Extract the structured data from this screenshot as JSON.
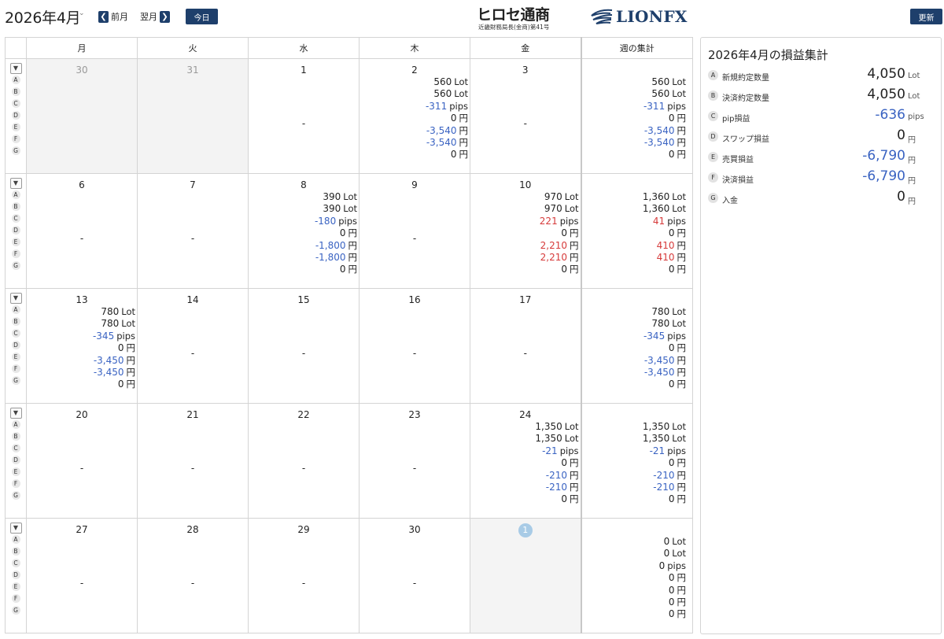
{
  "header": {
    "month_title": "2026年4月",
    "caret": "⌄",
    "prev_label": "前月",
    "next_label": "翌月",
    "today_label": "今日",
    "refresh_label": "更新",
    "hirose_logo": "ヒロセ通商",
    "hirose_sub": "近畿財務局長(金商)第41号",
    "lion_logo": "LIONFX"
  },
  "colors": {
    "brand_navy": "#1e3f6b",
    "logo_orange": "#e2621b",
    "negative_value": "#3a63c2",
    "positive_value": "#d63a3a",
    "today_marker": "#a8cbe6"
  },
  "calendar": {
    "weekday_headers": [
      "月",
      "火",
      "水",
      "木",
      "金"
    ],
    "week_summary_header": "週の集計",
    "legend_letters": [
      "A",
      "B",
      "C",
      "D",
      "E",
      "F",
      "G"
    ],
    "units": [
      "Lot",
      "Lot",
      "pips",
      "円",
      "円",
      "円",
      "円"
    ],
    "weeks": [
      {
        "days": [
          {
            "day": "30",
            "out_of_month": true,
            "values": null
          },
          {
            "day": "31",
            "out_of_month": true,
            "values": null
          },
          {
            "day": "1",
            "values": null
          },
          {
            "day": "2",
            "values": [
              {
                "v": "560",
                "s": "neu"
              },
              {
                "v": "560",
                "s": "neu"
              },
              {
                "v": "-311",
                "s": "neg"
              },
              {
                "v": "0",
                "s": "neu"
              },
              {
                "v": "-3,540",
                "s": "neg"
              },
              {
                "v": "-3,540",
                "s": "neg"
              },
              {
                "v": "0",
                "s": "neu"
              }
            ]
          },
          {
            "day": "3",
            "values": null
          }
        ],
        "summary": [
          {
            "v": "560",
            "s": "neu"
          },
          {
            "v": "560",
            "s": "neu"
          },
          {
            "v": "-311",
            "s": "neg"
          },
          {
            "v": "0",
            "s": "neu"
          },
          {
            "v": "-3,540",
            "s": "neg"
          },
          {
            "v": "-3,540",
            "s": "neg"
          },
          {
            "v": "0",
            "s": "neu"
          }
        ]
      },
      {
        "days": [
          {
            "day": "6",
            "values": null
          },
          {
            "day": "7",
            "values": null
          },
          {
            "day": "8",
            "values": [
              {
                "v": "390",
                "s": "neu"
              },
              {
                "v": "390",
                "s": "neu"
              },
              {
                "v": "-180",
                "s": "neg"
              },
              {
                "v": "0",
                "s": "neu"
              },
              {
                "v": "-1,800",
                "s": "neg"
              },
              {
                "v": "-1,800",
                "s": "neg"
              },
              {
                "v": "0",
                "s": "neu"
              }
            ]
          },
          {
            "day": "9",
            "values": null
          },
          {
            "day": "10",
            "values": [
              {
                "v": "970",
                "s": "neu"
              },
              {
                "v": "970",
                "s": "neu"
              },
              {
                "v": "221",
                "s": "pos"
              },
              {
                "v": "0",
                "s": "neu"
              },
              {
                "v": "2,210",
                "s": "pos"
              },
              {
                "v": "2,210",
                "s": "pos"
              },
              {
                "v": "0",
                "s": "neu"
              }
            ]
          }
        ],
        "summary": [
          {
            "v": "1,360",
            "s": "neu"
          },
          {
            "v": "1,360",
            "s": "neu"
          },
          {
            "v": "41",
            "s": "pos"
          },
          {
            "v": "0",
            "s": "neu"
          },
          {
            "v": "410",
            "s": "pos"
          },
          {
            "v": "410",
            "s": "pos"
          },
          {
            "v": "0",
            "s": "neu"
          }
        ]
      },
      {
        "days": [
          {
            "day": "13",
            "values": [
              {
                "v": "780",
                "s": "neu"
              },
              {
                "v": "780",
                "s": "neu"
              },
              {
                "v": "-345",
                "s": "neg"
              },
              {
                "v": "0",
                "s": "neu"
              },
              {
                "v": "-3,450",
                "s": "neg"
              },
              {
                "v": "-3,450",
                "s": "neg"
              },
              {
                "v": "0",
                "s": "neu"
              }
            ]
          },
          {
            "day": "14",
            "values": null
          },
          {
            "day": "15",
            "values": null
          },
          {
            "day": "16",
            "values": null
          },
          {
            "day": "17",
            "values": null
          }
        ],
        "summary": [
          {
            "v": "780",
            "s": "neu"
          },
          {
            "v": "780",
            "s": "neu"
          },
          {
            "v": "-345",
            "s": "neg"
          },
          {
            "v": "0",
            "s": "neu"
          },
          {
            "v": "-3,450",
            "s": "neg"
          },
          {
            "v": "-3,450",
            "s": "neg"
          },
          {
            "v": "0",
            "s": "neu"
          }
        ]
      },
      {
        "days": [
          {
            "day": "20",
            "values": null
          },
          {
            "day": "21",
            "values": null
          },
          {
            "day": "22",
            "values": null
          },
          {
            "day": "23",
            "values": null
          },
          {
            "day": "24",
            "values": [
              {
                "v": "1,350",
                "s": "neu"
              },
              {
                "v": "1,350",
                "s": "neu"
              },
              {
                "v": "-21",
                "s": "neg"
              },
              {
                "v": "0",
                "s": "neu"
              },
              {
                "v": "-210",
                "s": "neg"
              },
              {
                "v": "-210",
                "s": "neg"
              },
              {
                "v": "0",
                "s": "neu"
              }
            ]
          }
        ],
        "summary": [
          {
            "v": "1,350",
            "s": "neu"
          },
          {
            "v": "1,350",
            "s": "neu"
          },
          {
            "v": "-21",
            "s": "neg"
          },
          {
            "v": "0",
            "s": "neu"
          },
          {
            "v": "-210",
            "s": "neg"
          },
          {
            "v": "-210",
            "s": "neg"
          },
          {
            "v": "0",
            "s": "neu"
          }
        ]
      },
      {
        "days": [
          {
            "day": "27",
            "values": null
          },
          {
            "day": "28",
            "values": null
          },
          {
            "day": "29",
            "values": null
          },
          {
            "day": "30",
            "values": null
          },
          {
            "day": "1",
            "today": true,
            "values": null,
            "no_dash": true
          }
        ],
        "summary": [
          {
            "v": "0",
            "s": "neu"
          },
          {
            "v": "0",
            "s": "neu"
          },
          {
            "v": "0",
            "s": "neu"
          },
          {
            "v": "0",
            "s": "neu"
          },
          {
            "v": "0",
            "s": "neu"
          },
          {
            "v": "0",
            "s": "neu"
          },
          {
            "v": "0",
            "s": "neu"
          }
        ]
      }
    ]
  },
  "summary_panel": {
    "title": "2026年4月の損益集計",
    "rows": [
      {
        "letter": "A",
        "label": "新規約定数量",
        "value": "4,050",
        "unit": "Lot",
        "s": "neu"
      },
      {
        "letter": "B",
        "label": "決済約定数量",
        "value": "4,050",
        "unit": "Lot",
        "s": "neu"
      },
      {
        "letter": "C",
        "label": "pip損益",
        "value": "-636",
        "unit": "pips",
        "s": "neg"
      },
      {
        "letter": "D",
        "label": "スワップ損益",
        "value": "0",
        "unit": "円",
        "s": "neu"
      },
      {
        "letter": "E",
        "label": "売買損益",
        "value": "-6,790",
        "unit": "円",
        "s": "neg"
      },
      {
        "letter": "F",
        "label": "決済損益",
        "value": "-6,790",
        "unit": "円",
        "s": "neg"
      },
      {
        "letter": "G",
        "label": "入金",
        "value": "0",
        "unit": "円",
        "s": "neu"
      }
    ]
  }
}
